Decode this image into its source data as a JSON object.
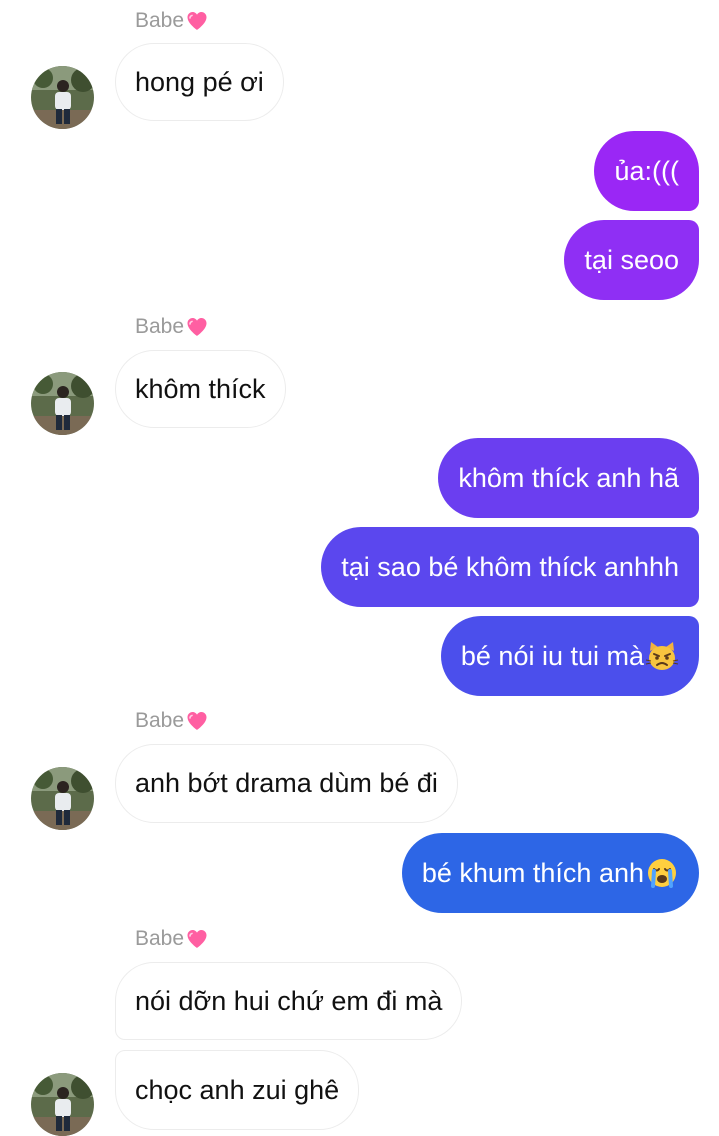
{
  "contact": {
    "display_name": "Babe",
    "name_icon": "pink-heart-icon",
    "avatar_icon": "person-avatar"
  },
  "messages": [
    {
      "from": "them",
      "text": "hong pé ơi"
    },
    {
      "from": "me",
      "text": "ủa:((("
    },
    {
      "from": "me",
      "text": "tại seoo"
    },
    {
      "from": "them",
      "text": "khôm thíck"
    },
    {
      "from": "me",
      "text": "khôm thíck anh hã"
    },
    {
      "from": "me",
      "text": "tại sao bé khôm thíck anhhh"
    },
    {
      "from": "me",
      "text": "bé nói iu tui mà",
      "emoji": "pouting-cat-icon"
    },
    {
      "from": "them",
      "text": "anh bớt drama dùm bé đi"
    },
    {
      "from": "me",
      "text": "bé khum thích anh",
      "emoji": "loudly-crying-face-icon"
    },
    {
      "from": "them",
      "text": "nói dỡn hui chứ em đi mà"
    },
    {
      "from": "them",
      "text": "chọc anh zui ghê"
    }
  ],
  "colors": {
    "outgoing_gradient_top": "#9b27f5",
    "outgoing_gradient_bottom": "#2b69e6",
    "incoming_bg": "#ffffff",
    "incoming_border": "#ececec",
    "sender_name": "#9a9a9a"
  }
}
